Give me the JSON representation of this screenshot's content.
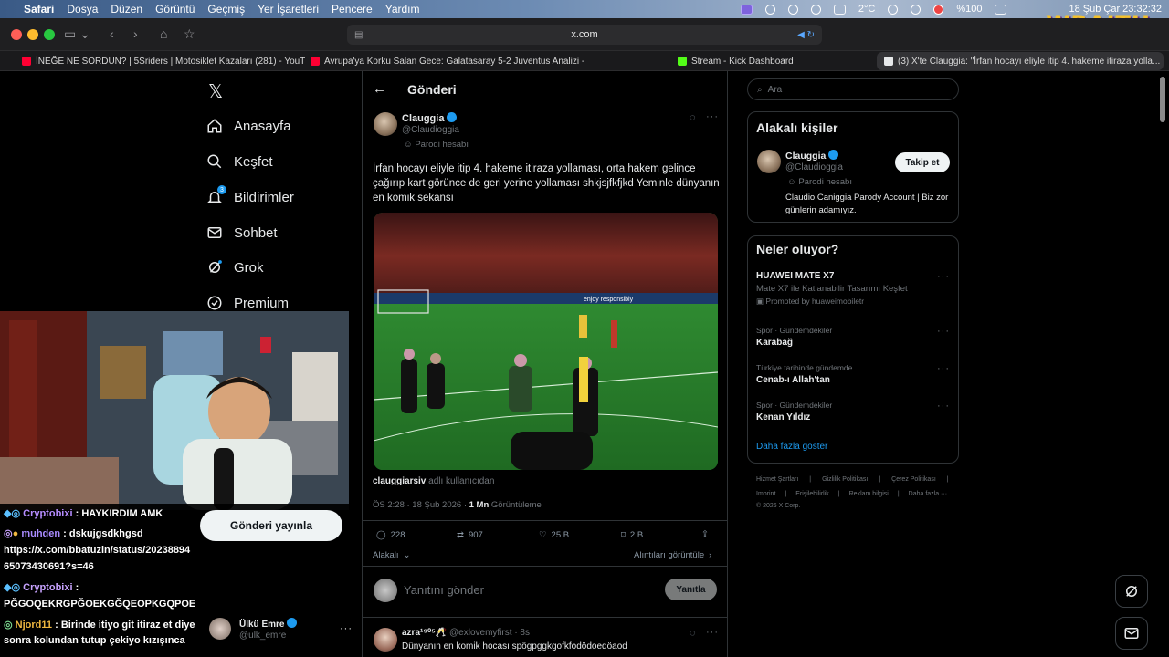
{
  "menubar": {
    "items": [
      "Safari",
      "Dosya",
      "Düzen",
      "Görüntü",
      "Geçmiş",
      "Yer İşaretleri",
      "Pencere",
      "Yardım"
    ],
    "temp": "2°C",
    "battery": "%100",
    "datetime": "18 Şub Çar  23:32:32"
  },
  "overlay_logo": "WRAITH",
  "browser": {
    "address": "x.com",
    "tabs": [
      {
        "label": "İNEĞE NE SORDUN? | 5Sriders | Motosiklet Kazaları (281) - YouTube",
        "color": "#ff0033"
      },
      {
        "label": "Avrupa'ya Korku Salan Gece: Galatasaray 5-2 Juventus Analizi - You...",
        "color": "#ff0033"
      },
      {
        "label": "Stream - Kick Dashboard",
        "color": "#53fc18"
      },
      {
        "label": "(3) X'te Clauggia: \"İrfan hocayı eliyle itip 4. hakeme itiraza yolla...",
        "color": "#e7e9ea"
      }
    ]
  },
  "nav": {
    "logo": "𝕏",
    "items": [
      {
        "label": "Anasayfa",
        "icon": "home-icon"
      },
      {
        "label": "Keşfet",
        "icon": "search-icon"
      },
      {
        "label": "Bildirimler",
        "icon": "bell-icon",
        "badge": "3"
      },
      {
        "label": "Sohbet",
        "icon": "mail-icon"
      },
      {
        "label": "Grok",
        "icon": "grok-icon"
      },
      {
        "label": "Premium",
        "icon": "premium-icon"
      }
    ],
    "post_button": "Gönderi yayınla"
  },
  "post": {
    "header": "Gönderi",
    "author_name": "Clauggia",
    "author_handle": "@Claudioggia",
    "parody_label": "Parodi hesabı",
    "text": "İrfan hocayı eliyle itip 4. hakeme itiraza yollaması, orta hakem gelince çağırıp kart görünce de geri yerine yollaması shkjsjfkfjkd Yeminle dünyanın en komik sekansı",
    "image_banner": "enjoy responsibly",
    "credit_user": "clauggiarsiv",
    "credit_suffix": "adlı kullanıcıdan",
    "time": "ÖS 2:28 · 18 Şub 2026 ·",
    "views": "1 Mn",
    "views_label": "Görüntüleme",
    "replies": "228",
    "reposts": "907",
    "likes": "25 B",
    "bookmarks": "2 B",
    "related": "Alakalı",
    "quotes_link": "Alıntıları görüntüle",
    "reply_placeholder": "Yanıtını gönder",
    "reply_button": "Yanıtla"
  },
  "reply": {
    "author_name": "azra¹⁹⁰⁵🥂",
    "author_handle": "@exlovemyfirst",
    "age": "· 8s",
    "text": "Dünyanın en komik hocası spögpggkgofkfodödoeqöaod"
  },
  "sidebar": {
    "search_placeholder": "Ara",
    "related_title": "Alakalı kişiler",
    "related_name": "Clauggia",
    "related_handle": "@Claudioggia",
    "related_parody": "Parodi hesabı",
    "related_bio": "Claudio Caniggia Parody Account | Biz zor günlerin adamıyız.",
    "follow_button": "Takip et",
    "trends_title": "Neler oluyor?",
    "trends": [
      {
        "meta": "",
        "name": "HUAWEI MATE X7",
        "sub": "Mate X7 ile Katlanabilir Tasarımı Keşfet",
        "promo": "Promoted by huaweimobiletr"
      },
      {
        "meta": "Spor · Gündemdekiler",
        "name": "Karabağ"
      },
      {
        "meta": "Türkiye tarihinde gündemde",
        "name": "Cenab-ı Allah'tan"
      },
      {
        "meta": "Spor · Gündemdekiler",
        "name": "Kenan Yıldız"
      }
    ],
    "show_more": "Daha fazla göster",
    "footer_line1": [
      "Hizmet Şartları",
      "Gizlilik Politikası",
      "Çerez Politikası"
    ],
    "footer_line2": [
      "Imprint",
      "Erişilebilirlik",
      "Reklam bilgisi",
      "Daha fazla ···"
    ],
    "copyright": "© 2026 X Corp."
  },
  "chat": [
    {
      "user": "Cryptobixi",
      "msg": ": HAYKIRDIM AMK",
      "cls": "cu1"
    },
    {
      "user": "muhden",
      "msg": ": dskujgsdkhgsd",
      "cls": "cu2"
    },
    {
      "user": "",
      "msg": "https://x.com/bbatuzin/status/20238894",
      "cls": ""
    },
    {
      "user": "",
      "msg": "65073430691?s=46",
      "cls": ""
    },
    {
      "user": "Cryptobixi",
      "msg": ":",
      "cls": "cu3"
    },
    {
      "user": "",
      "msg": "PĞGOQEKRGPĞOEKGĞQEOPKGQPOE",
      "cls": ""
    },
    {
      "user": "Njord11",
      "msg": ": Birinde itiyo git itiraz et diye",
      "cls": "cu4"
    },
    {
      "user": "",
      "msg": "sonra kolundan tutup çekiyo kızışınca",
      "cls": ""
    }
  ],
  "account": {
    "name": "Ülkü Emre",
    "handle": "@ulk_emre"
  },
  "colors": {
    "accent": "#1d9bf0",
    "background": "#000000",
    "border": "#2f3336"
  }
}
